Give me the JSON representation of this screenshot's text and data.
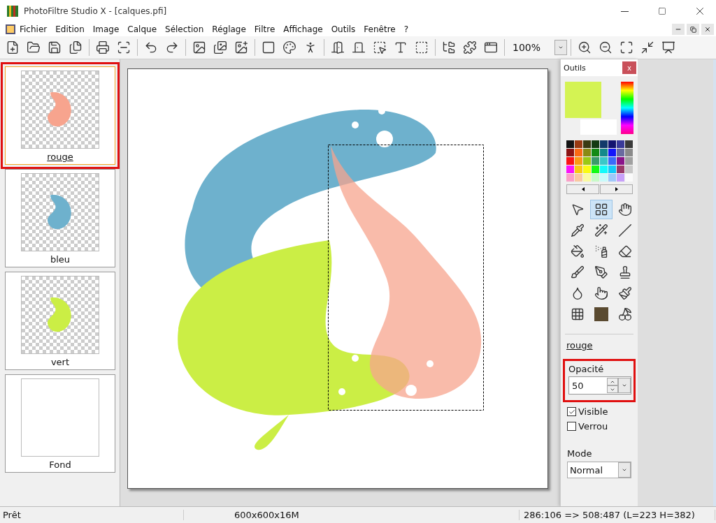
{
  "window": {
    "title": "PhotoFiltre Studio X - [calques.pfi]"
  },
  "menu": [
    "Fichier",
    "Edition",
    "Image",
    "Calque",
    "Sélection",
    "Réglage",
    "Filtre",
    "Affichage",
    "Outils",
    "Fenêtre",
    "?"
  ],
  "toolbar": {
    "zoom": "100%"
  },
  "layers": [
    {
      "name": "rouge",
      "kind": "transparent",
      "color": "#f7a48e",
      "selected": true
    },
    {
      "name": "bleu",
      "kind": "transparent",
      "color": "#6eb1cd",
      "selected": false
    },
    {
      "name": "vert",
      "kind": "transparent",
      "color": "#cbee45",
      "selected": false
    },
    {
      "name": "Fond",
      "kind": "background",
      "selected": false
    }
  ],
  "tools_panel": {
    "title": "Outils",
    "close": "x",
    "colors": [
      {
        "color": "#d4f353"
      },
      {
        "color": "#ffffff"
      }
    ],
    "palette": [
      {
        "color": "#141414"
      },
      {
        "color": "#9a3a12"
      },
      {
        "color": "#3a3a12"
      },
      {
        "color": "#143a14"
      },
      {
        "color": "#123a6a"
      },
      {
        "color": "#141470"
      },
      {
        "color": "#3a3a9a"
      },
      {
        "color": "#3a3a3a"
      },
      {
        "color": "#8a1414"
      },
      {
        "color": "#fa6a14"
      },
      {
        "color": "#8a8a14"
      },
      {
        "color": "#148a14"
      },
      {
        "color": "#148a8a"
      },
      {
        "color": "#1414fa"
      },
      {
        "color": "#6a6aa0"
      },
      {
        "color": "#8a8a8a"
      },
      {
        "color": "#fa1414"
      },
      {
        "color": "#fa9a14"
      },
      {
        "color": "#9ac814"
      },
      {
        "color": "#3a9a6a"
      },
      {
        "color": "#3ac8c8"
      },
      {
        "color": "#3a6afa"
      },
      {
        "color": "#8a148a"
      },
      {
        "color": "#a0a0a0"
      },
      {
        "color": "#fa14fa"
      },
      {
        "color": "#fac814"
      },
      {
        "color": "#fafa14"
      },
      {
        "color": "#14fa14"
      },
      {
        "color": "#14fafa"
      },
      {
        "color": "#14c8fa"
      },
      {
        "color": "#9a3a6a"
      },
      {
        "color": "#c8c8c8"
      },
      {
        "color": "#faa0c8"
      },
      {
        "color": "#fac8a0"
      },
      {
        "color": "#fafaa0"
      },
      {
        "color": "#c8fac8"
      },
      {
        "color": "#c8fafa"
      },
      {
        "color": "#a0c8fa"
      },
      {
        "color": "#c8a0fa"
      },
      {
        "color": "#fafafa"
      }
    ],
    "tools": [
      {
        "kind": "pointer",
        "selected": false
      },
      {
        "kind": "layers",
        "selected": true
      },
      {
        "kind": "hand",
        "selected": false
      },
      {
        "kind": "eyedropper",
        "selected": false
      },
      {
        "kind": "wand",
        "selected": false
      },
      {
        "kind": "line",
        "selected": false
      },
      {
        "kind": "fill",
        "selected": false
      },
      {
        "kind": "spray",
        "selected": false
      },
      {
        "kind": "eraser",
        "selected": false
      },
      {
        "kind": "brush",
        "selected": false
      },
      {
        "kind": "brushplus",
        "selected": false
      },
      {
        "kind": "stamp",
        "selected": false
      },
      {
        "kind": "drop",
        "selected": false
      },
      {
        "kind": "smudge",
        "selected": false
      },
      {
        "kind": "paintbrush",
        "selected": false
      },
      {
        "kind": "grid",
        "selected": false
      },
      {
        "kind": "portrait",
        "selected": false
      },
      {
        "kind": "fruit",
        "selected": false
      }
    ],
    "layer_name": "rouge",
    "opacity": {
      "label": "Opacité",
      "value": "50",
      "highlighted": true
    },
    "options": [
      {
        "label": "Visible",
        "checked": true
      },
      {
        "label": "Verrou",
        "checked": false
      }
    ],
    "mode": {
      "label": "Mode",
      "value": "Normal"
    }
  },
  "status_bar": [
    "Prêt",
    "600x600x16M",
    "286:106 => 508:487 (L=223 H=382)"
  ]
}
